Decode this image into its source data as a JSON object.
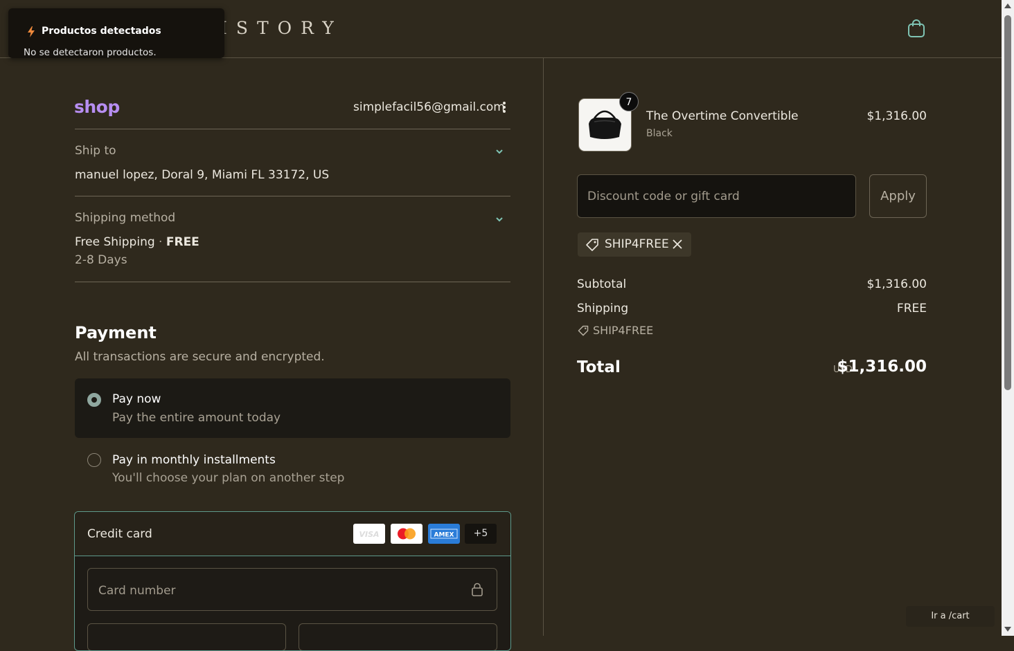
{
  "header": {
    "brand": "ISTORY"
  },
  "toast": {
    "title": "Productos detectados",
    "message": "No se detectaron productos."
  },
  "account": {
    "logo": "shop",
    "email": "simplefacil56@gmail.com"
  },
  "ship_to": {
    "label": "Ship to",
    "value": "manuel lopez, Doral 9, Miami FL 33172, US"
  },
  "shipping_method": {
    "label": "Shipping method",
    "name": "Free Shipping",
    "separator": "·",
    "price": "FREE",
    "eta": "2-8 Days"
  },
  "payment": {
    "title": "Payment",
    "subtitle": "All transactions are secure and encrypted.",
    "options": [
      {
        "title": "Pay now",
        "subtitle": "Pay the entire amount today",
        "selected": true
      },
      {
        "title": "Pay in monthly installments",
        "subtitle": "You'll choose your plan on another step",
        "selected": false
      }
    ],
    "credit_card": {
      "label": "Credit card",
      "brands": [
        "VISA",
        "mastercard",
        "AMEX"
      ],
      "more": "+5",
      "card_number_placeholder": "Card number"
    }
  },
  "order": {
    "item": {
      "name": "The Overtime Convertible",
      "variant": "Black",
      "price": "$1,316.00",
      "quantity": "7"
    },
    "discount": {
      "placeholder": "Discount code or gift card",
      "apply_label": "Apply",
      "applied_code": "SHIP4FREE"
    },
    "subtotal_label": "Subtotal",
    "subtotal": "$1,316.00",
    "shipping_label": "Shipping",
    "shipping": "FREE",
    "shipping_code": "SHIP4FREE",
    "total_label": "Total",
    "currency": "USD",
    "total": "$1,316.00"
  },
  "cart_link": "Ir a /cart",
  "colors": {
    "background": "#2f291d",
    "shop_purple": "#b78ef2",
    "accent_teal": "#5e9a8c"
  }
}
